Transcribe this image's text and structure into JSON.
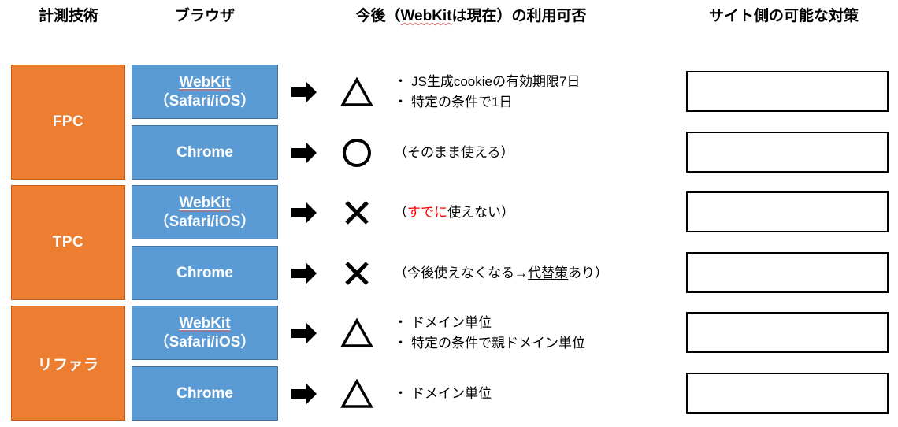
{
  "headers": {
    "technique": "計測技術",
    "browser": "ブラウザ",
    "availability_prefix": "今後（",
    "availability_webkit": "WebKit",
    "availability_suffix": "は現在）の利用可否",
    "action": "サイト側の可能な対策"
  },
  "techniques": [
    {
      "label": "FPC"
    },
    {
      "label": "TPC"
    },
    {
      "label": "リファラ"
    }
  ],
  "rows": [
    {
      "browser_main": "WebKit",
      "browser_sub": "（Safari/iOS）",
      "browser_main_underlined": true,
      "browser_main_spellcheck": true,
      "arrow_icon": "right-arrow-icon",
      "symbol": "△",
      "symbol_icon": "triangle-icon",
      "notes_style": "bullets",
      "notes": [
        {
          "dot": "・",
          "text": "JS生成cookieの有効期限7日"
        },
        {
          "dot": "・",
          "text": "特定の条件で1日"
        }
      ]
    },
    {
      "browser_main": "Chrome",
      "browser_sub": "",
      "browser_main_underlined": false,
      "browser_main_spellcheck": false,
      "arrow_icon": "right-arrow-icon",
      "symbol": "○",
      "symbol_icon": "circle-icon",
      "notes_style": "plain",
      "notes": [
        {
          "dot": "",
          "text": "（そのまま使える）"
        }
      ]
    },
    {
      "browser_main": "WebKit",
      "browser_sub": "（Safari/iOS）",
      "browser_main_underlined": true,
      "browser_main_spellcheck": true,
      "arrow_icon": "right-arrow-icon",
      "symbol": "×",
      "symbol_icon": "cross-icon",
      "notes_style": "rich_red",
      "notes": [
        {
          "dot": "",
          "text": "（すでに使えない）",
          "red_part": "すでに",
          "pre": "（",
          "post": "使えない）"
        }
      ]
    },
    {
      "browser_main": "Chrome",
      "browser_sub": "",
      "browser_main_underlined": false,
      "browser_main_spellcheck": false,
      "arrow_icon": "right-arrow-icon",
      "symbol": "×",
      "symbol_icon": "cross-icon",
      "notes_style": "rich_underline",
      "notes": [
        {
          "dot": "",
          "text": "（今後使えなくなる→代替策あり）",
          "pre": "（今後使えなくなる→",
          "underlined_part": "代替策",
          "post": "あり）"
        }
      ]
    },
    {
      "browser_main": "WebKit",
      "browser_sub": "（Safari/iOS）",
      "browser_main_underlined": true,
      "browser_main_spellcheck": true,
      "arrow_icon": "right-arrow-icon",
      "symbol": "△",
      "symbol_icon": "triangle-icon",
      "notes_style": "bullets",
      "notes": [
        {
          "dot": "・",
          "text": "ドメイン単位"
        },
        {
          "dot": "・",
          "text": "特定の条件で親ドメイン単位"
        }
      ]
    },
    {
      "browser_main": "Chrome",
      "browser_sub": "",
      "browser_main_underlined": false,
      "browser_main_spellcheck": false,
      "arrow_icon": "right-arrow-icon",
      "symbol": "△",
      "symbol_icon": "triangle-icon",
      "notes_style": "bullets",
      "notes": [
        {
          "dot": "・",
          "text": "ドメイン単位"
        }
      ]
    }
  ],
  "action_boxes": [
    {
      "value": ""
    },
    {
      "value": ""
    },
    {
      "value": ""
    },
    {
      "value": ""
    },
    {
      "value": ""
    },
    {
      "value": ""
    }
  ],
  "colors": {
    "technique_fill": "#ED7D31",
    "technique_border": "#C55A11",
    "browser_fill": "#5B9BD5",
    "browser_border": "#41719C",
    "accent_red": "#FF0000",
    "spellcheck_red": "#D05B5B",
    "box_border": "#000000",
    "text": "#000000",
    "inverse_text": "#FFFFFF"
  }
}
